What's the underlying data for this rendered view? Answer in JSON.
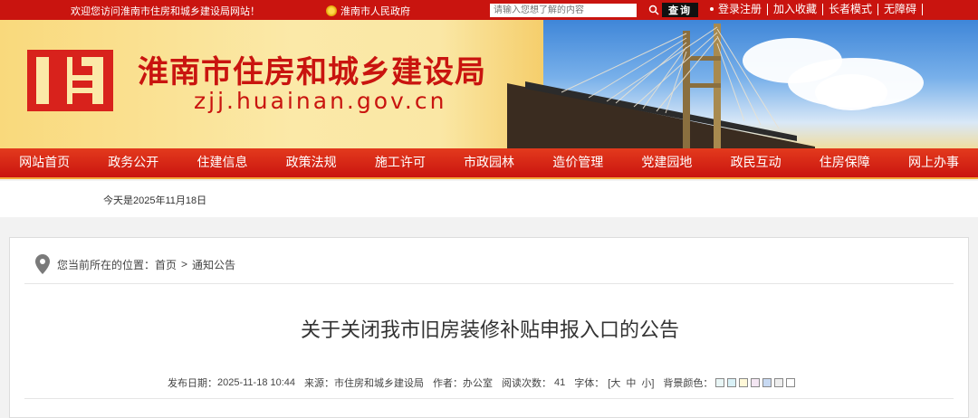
{
  "topbar": {
    "welcome": "欢迎您访问淮南市住房和城乡建设局网站！",
    "gov_link": "淮南市人民政府",
    "search_placeholder": "请输入您想了解的内容",
    "search_button": "查询",
    "links": [
      "登录注册",
      "加入收藏",
      "长者模式",
      "无障碍"
    ]
  },
  "banner": {
    "title": "淮南市住房和城乡建设局",
    "domain": "zjj.huainan.gov.cn"
  },
  "nav": {
    "items": [
      "网站首页",
      "政务公开",
      "住建信息",
      "政策法规",
      "施工许可",
      "市政园林",
      "造价管理",
      "党建园地",
      "政民互动",
      "住房保障",
      "网上办事"
    ]
  },
  "date_strip": {
    "text": "今天是2025年11月18日"
  },
  "content": {
    "location_label": "您当前所在的位置：",
    "crumbs": [
      "首页",
      "通知公告"
    ],
    "crumb_sep": ">",
    "title": "关于关闭我市旧房装修补贴申报入口的公告",
    "meta": {
      "date_label": "发布日期：",
      "date": "2025-11-18 10:44",
      "source_label": "来源：",
      "source": "市住房和城乡建设局",
      "author_label": "作者：",
      "author": "办公室",
      "views_label": "阅读次数：",
      "views": "41",
      "font_label": "字体：",
      "font_sizes": [
        "[大",
        "中",
        "小]"
      ],
      "bg_label": "背景颜色：",
      "bg_colors": [
        "#e9f6f6",
        "#d9f1f7",
        "#fff8d8",
        "#f4e6f3",
        "#c7d9f2",
        "#eeeeee",
        "#ffffff"
      ]
    }
  }
}
